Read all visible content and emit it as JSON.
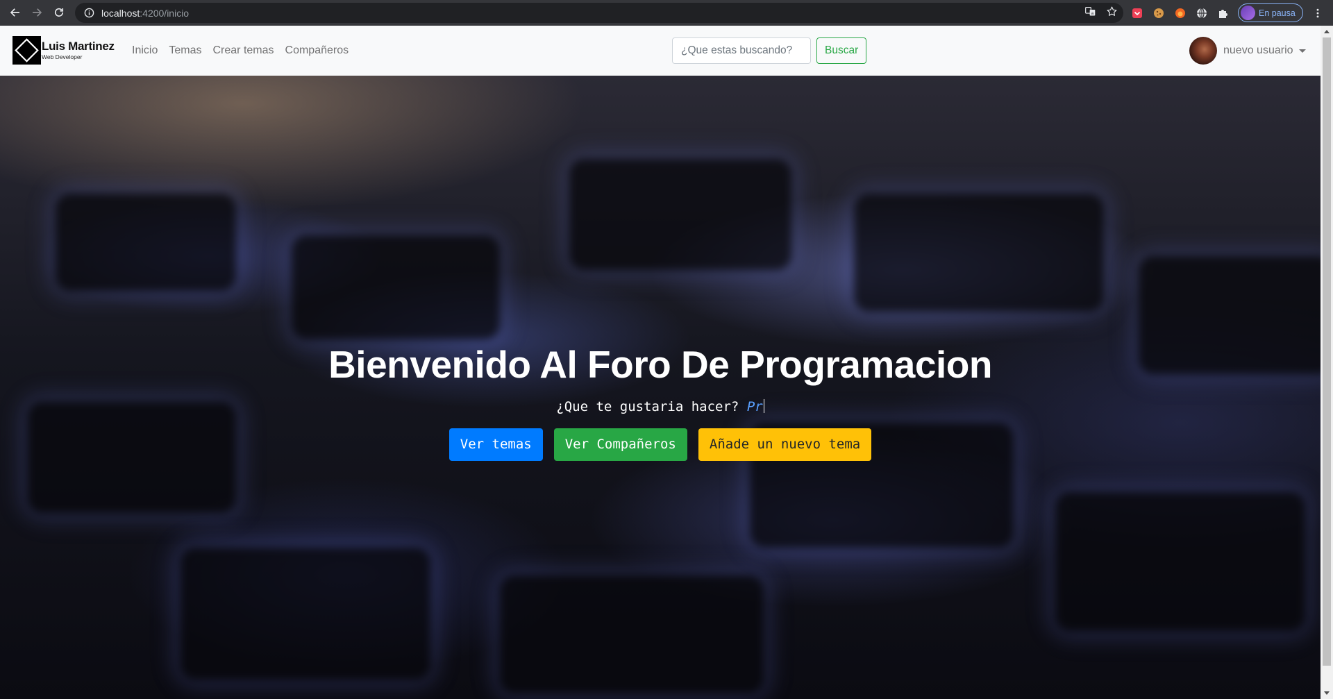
{
  "browser": {
    "url_host": "localhost",
    "url_path": ":4200/inicio",
    "profile_status": "En pausa",
    "icons": [
      "back-icon",
      "forward-icon",
      "reload-icon",
      "info-icon",
      "translate-icon",
      "star-icon",
      "extension-icon",
      "puzzle-icon",
      "menu-icon"
    ]
  },
  "brand": {
    "name": "Luis Martinez",
    "subtitle": "Web Developer"
  },
  "nav": {
    "links": [
      "Inicio",
      "Temas",
      "Crear temas",
      "Compañeros"
    ]
  },
  "search": {
    "placeholder": "¿Que estas buscando?",
    "button_label": "Buscar"
  },
  "user": {
    "name": "nuevo usuario"
  },
  "hero": {
    "title": "Bienvenido Al Foro De Programacion",
    "subtitle": "¿Que te gustaria hacer?",
    "typed_text": "Pr",
    "buttons": [
      "Ver temas",
      "Ver Compañeros",
      "Añade un nuevo tema"
    ]
  },
  "colors": {
    "primary": "#007bff",
    "success": "#28a745",
    "warning": "#ffc107",
    "navbar_bg": "#f8f9fa",
    "chrome_bg": "#35363a"
  }
}
